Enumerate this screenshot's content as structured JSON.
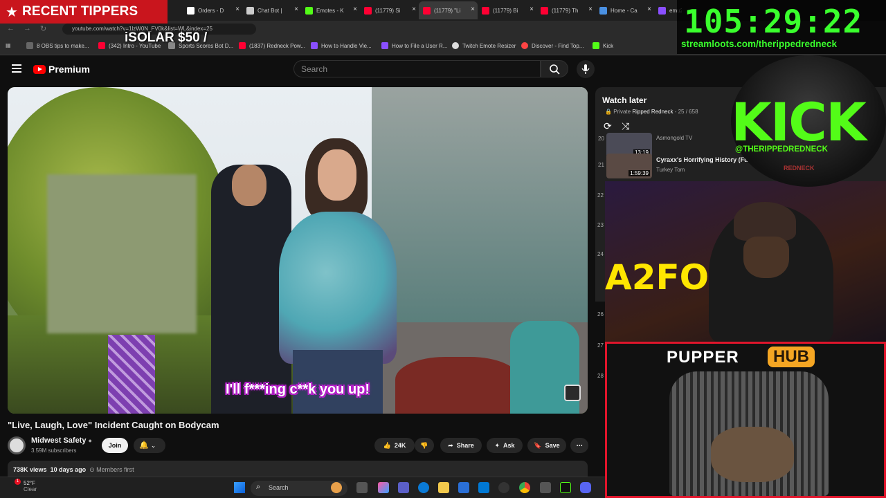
{
  "overlay": {
    "tippers_label": "RECENT TIPPERS",
    "tip_line": "iSOLAR $50 /",
    "timer": "105:29:22",
    "timer_url": "streamloots.com/therippedredneck",
    "kick_logo": "KICK",
    "kick_handle": "@THERIPPEDREDNECK",
    "kick_subtitle": "REDNECK",
    "cam_sign": "A2FO",
    "pupper_label1": "PUPPER",
    "pupper_label2": "HUB"
  },
  "browser": {
    "tabs": [
      {
        "label": "Orders - D",
        "color": "#ffffff"
      },
      {
        "label": "Chat Bot |",
        "color": "#cccccc"
      },
      {
        "label": "Emotes - K",
        "color": "#53fc18"
      },
      {
        "label": "(11779) Si",
        "color": "#ff0033"
      },
      {
        "label": "(11779) \"Li",
        "color": "#ff0033"
      },
      {
        "label": "(11779) Bi",
        "color": "#ff0033"
      },
      {
        "label": "(11779) Th",
        "color": "#ff0033"
      },
      {
        "label": "Home - Ca",
        "color": "#4a90e2"
      },
      {
        "label": "emu2",
        "color": "#8a4fff"
      }
    ],
    "url": "youtube.com/watch?v=1lzW0N_FV0k&list=WL&index=25",
    "bookmarks": [
      {
        "label": "8 OBS tips to make...",
        "color": "#666666"
      },
      {
        "label": "(342) Intro - YouTube",
        "color": "#ff0033"
      },
      {
        "label": "Sports Scores Bot D...",
        "color": "#888888"
      },
      {
        "label": "(1837) Redneck Pow...",
        "color": "#ff0033"
      },
      {
        "label": "How to Handle Vie...",
        "color": "#8a4fff"
      },
      {
        "label": "How to File a User R...",
        "color": "#8a4fff"
      },
      {
        "label": "Twitch Emote Resizer",
        "color": "#dddddd"
      },
      {
        "label": "Discover - Find Top...",
        "color": "#ff4444"
      },
      {
        "label": "Kick",
        "color": "#53fc18"
      }
    ]
  },
  "youtube": {
    "logo": "Premium",
    "search_placeholder": "Search",
    "subtitle": "I'll f***ing c**k you up!",
    "video_title": "\"Live, Laugh, Love\" Incident Caught on Bodycam",
    "channel": "Midwest Safety",
    "subscribers": "3.59M subscribers",
    "join": "Join",
    "likes": "24K",
    "share": "Share",
    "ask": "Ask",
    "save": "Save",
    "views": "738K views",
    "age": "10 days ago",
    "members": "Members first"
  },
  "playlist": {
    "title": "Watch later",
    "privacy": "Private",
    "owner": "Ripped Redneck",
    "position": "25 / 658",
    "items": [
      {
        "num": "20",
        "duration": "13:19",
        "title": "",
        "channel": "Asmongold TV"
      },
      {
        "num": "21",
        "duration": "1:59:39",
        "title": "Cyraxx's Horrifying History (Ful",
        "channel": "Turkey Tom"
      }
    ],
    "side_numbers": [
      "22",
      "23",
      "24",
      "26",
      "27",
      "28"
    ]
  },
  "taskbar": {
    "temp": "52°F",
    "condition": "Clear",
    "badge": "1",
    "search": "Search"
  }
}
